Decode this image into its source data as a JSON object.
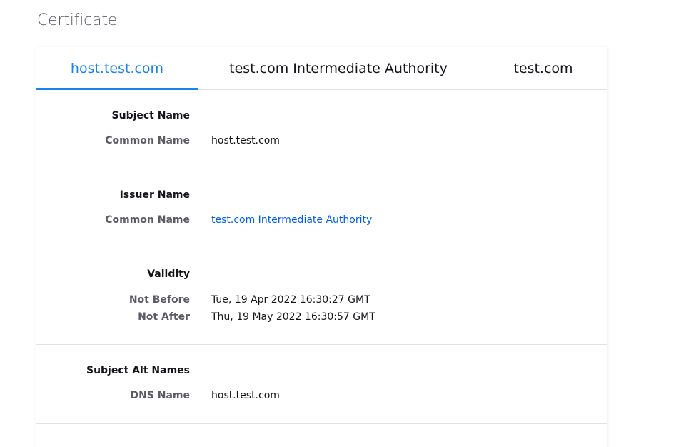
{
  "page": {
    "title": "Certificate"
  },
  "tabs": [
    {
      "label": "host.test.com",
      "active": true
    },
    {
      "label": "test.com Intermediate Authority",
      "active": false
    },
    {
      "label": "test.com",
      "active": false
    }
  ],
  "sections": {
    "subject": {
      "heading": "Subject Name",
      "rows": [
        {
          "label": "Common Name",
          "value": "host.test.com"
        }
      ]
    },
    "issuer": {
      "heading": "Issuer Name",
      "rows": [
        {
          "label": "Common Name",
          "value": "test.com Intermediate Authority"
        }
      ]
    },
    "validity": {
      "heading": "Validity",
      "rows": [
        {
          "label": "Not Before",
          "value": "Tue, 19 Apr 2022 16:30:27 GMT"
        },
        {
          "label": "Not After",
          "value": "Thu, 19 May 2022 16:30:57 GMT"
        }
      ]
    },
    "alt_names": {
      "heading": "Subject Alt Names",
      "rows": [
        {
          "label": "DNS Name",
          "value": "host.test.com"
        }
      ]
    }
  },
  "colors": {
    "accent": "#1a83e6",
    "link": "#0060df",
    "label": "#5b5b66",
    "divider": "#e0e0e6"
  }
}
